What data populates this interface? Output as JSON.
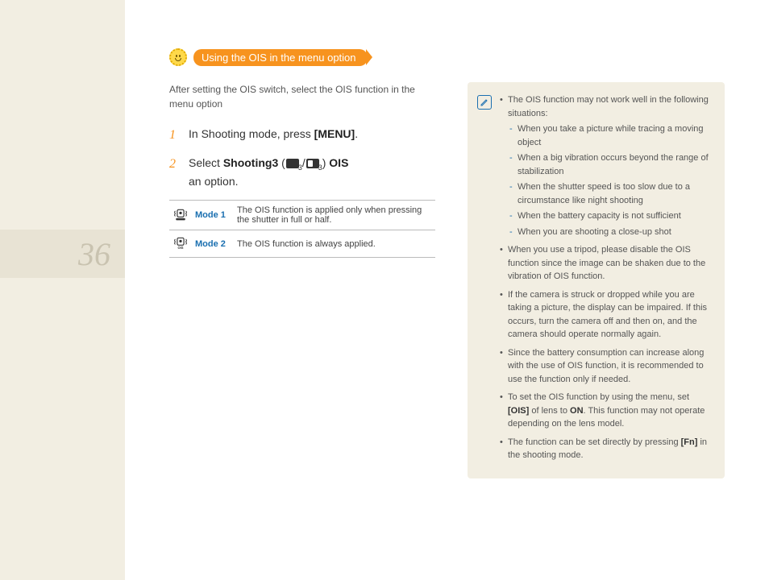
{
  "page_number": "36",
  "heading": "Using the OIS in the menu option",
  "intro": "After setting the OIS switch, select the OIS function in the menu option",
  "steps": [
    {
      "pre": "In Shooting mode, press ",
      "tag": "[MENU]",
      "post": "."
    },
    {
      "pre": "Select ",
      "bold1": "Shooting3",
      "mid": " (",
      "sub1": "3",
      "slash": "/",
      "sub2": "3",
      "mid2": ") ",
      "arrow": "→",
      "bold2": " OIS ",
      "arrow2": "→",
      "line2": "an option."
    }
  ],
  "modes": [
    {
      "label": "Mode 1",
      "desc": "The OIS function is applied only when pressing the shutter in full or half."
    },
    {
      "label": "Mode 2",
      "desc": "The OIS function is always applied."
    }
  ],
  "note_icon_glyph": "✎",
  "notes": {
    "n0": "The OIS function may not work well in the following situations:",
    "subs": [
      "When you take a picture while tracing a moving object",
      "When a big vibration occurs beyond the range of stabilization",
      "When the shutter speed is too slow due to a circumstance like night shooting",
      "When the battery capacity is not sufficient",
      "When you are shooting a close-up shot"
    ],
    "n1": "When you use a tripod, please disable the OIS function since the image can be shaken due to the vibration of OIS function.",
    "n2": "If the camera is struck or dropped while you are taking a picture, the display can be impaired. If this occurs, turn the camera off and then on, and the camera should operate normally again.",
    "n3": "Since the battery consumption can increase along with the use of OIS function, it is recommended to use the function only if needed.",
    "n4_pre": "To set the OIS function by using the menu, set ",
    "n4_k1": "[OIS]",
    "n4_mid": " of lens to ",
    "n4_k2": "ON",
    "n4_post": ". This function may not operate depending on the lens model.",
    "n5_pre": "The function can be set directly by pressing ",
    "n5_k": "[Fn]",
    "n5_post": " in the shooting mode."
  }
}
